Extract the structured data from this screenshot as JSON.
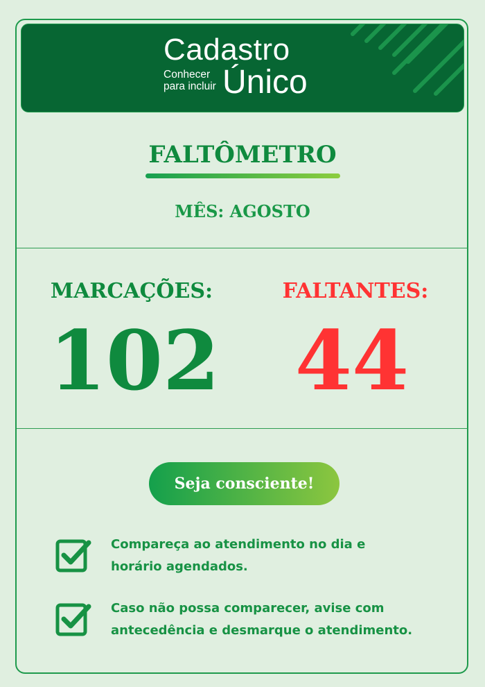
{
  "header": {
    "logo_main": "Cadastro",
    "logo_sub_line1": "Conhecer",
    "logo_sub_line2": "para incluir",
    "logo_unico": "Único"
  },
  "title": "FALTÔMETRO",
  "month": "MÊS: AGOSTO",
  "stats": {
    "marcacoes_label": "MARCAÇÕES:",
    "marcacoes_value": "102",
    "faltantes_label": "FALTANTES:",
    "faltantes_value": "44"
  },
  "cta": "Seja consciente!",
  "tips": [
    {
      "line1": "Compareça ao atendimento no dia e",
      "line2": "horário agendados."
    },
    {
      "line1": "Caso não possa comparecer, avise com",
      "line2": "antecedência e desmarque o atendimento."
    }
  ],
  "colors": {
    "background": "#e0efe0",
    "header": "#076633",
    "green": "#0f8a3e",
    "red": "#ff3333"
  },
  "icons": [
    "check-square-icon"
  ]
}
